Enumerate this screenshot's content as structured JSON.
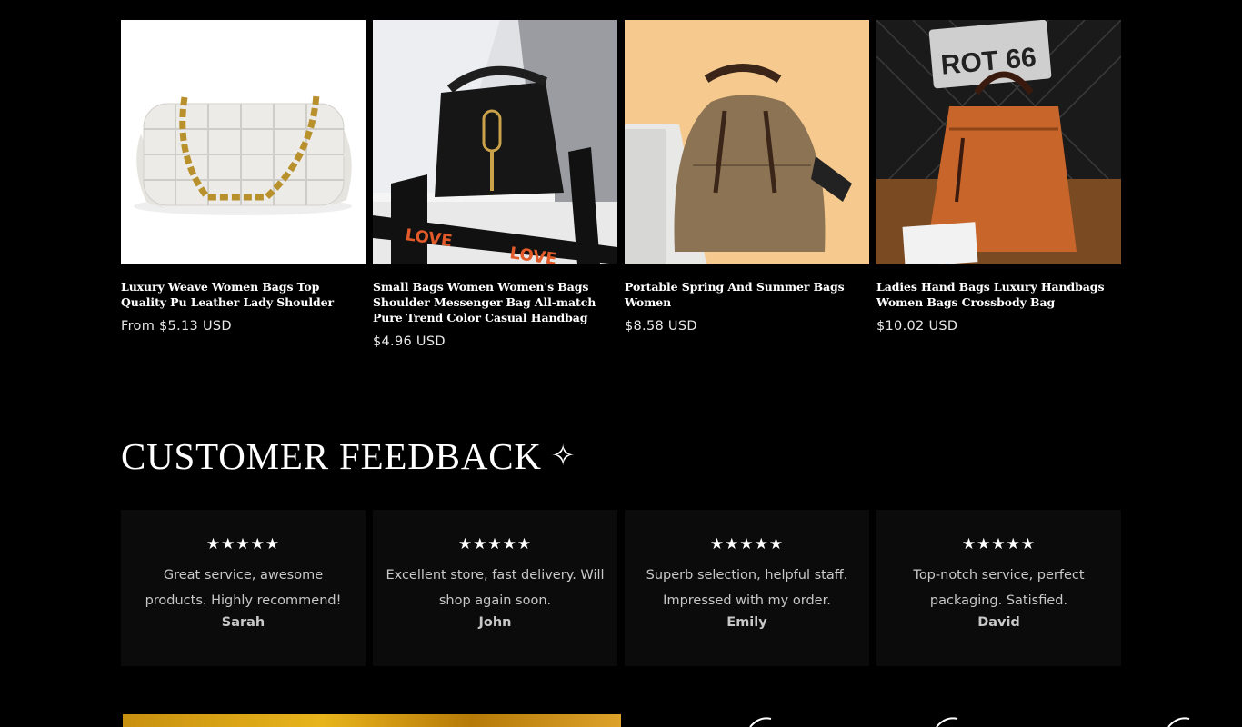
{
  "products": [
    {
      "title": "Luxury Weave Women Bags Top Quality Pu Leather Lady Shoulder",
      "price": "From $5.13 USD",
      "image": "white-woven-chain-bag"
    },
    {
      "title": "Small Bags Women Women's Bags Shoulder Messenger Bag All-match Pure Trend Color Casual Handbag",
      "price": "$4.96 USD",
      "image": "black-bucket-bag-love-strap"
    },
    {
      "title": "Portable Spring And Summer Bags Women",
      "price": "$8.58 USD",
      "image": "taupe-dome-handbag"
    },
    {
      "title": "Ladies Hand Bags Luxury Handbags Women Bags Crossbody Bag",
      "price": "$10.02 USD",
      "image": "orange-leather-tote"
    }
  ],
  "feedback": {
    "heading": "CUSTOMER FEEDBACK",
    "sparkle": "✧",
    "reviews": [
      {
        "stars": "★★★★★",
        "text": "Great service, awesome products. Highly recommend!",
        "name": "Sarah"
      },
      {
        "stars": "★★★★★",
        "text": "Excellent store, fast delivery. Will shop again soon.",
        "name": "John"
      },
      {
        "stars": "★★★★★",
        "text": "Superb selection, helpful staff. Impressed with my order.",
        "name": "Emily"
      },
      {
        "stars": "★★★★★",
        "text": "Top-notch service, perfect packaging. Satisfied.",
        "name": "David"
      }
    ]
  },
  "bag2_strap_text": "LOVE",
  "bag4_sign_text": "ROT 66",
  "colors": {
    "background": "#000000",
    "card": "#0b0b0b",
    "text": "#ffffff",
    "muted": "#c8c8c8"
  }
}
